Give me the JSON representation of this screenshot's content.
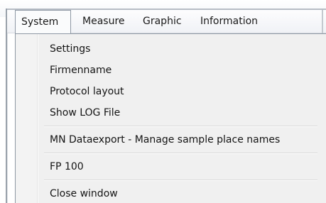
{
  "menubar": {
    "items": [
      {
        "label": "System"
      },
      {
        "label": "Measure"
      },
      {
        "label": "Graphic"
      },
      {
        "label": "Information"
      }
    ]
  },
  "dropdown": {
    "items": [
      {
        "label": "Settings"
      },
      {
        "label": "Firmenname"
      },
      {
        "label": "Protocol layout"
      },
      {
        "label": "Show LOG File"
      },
      {
        "label": "MN Dataexport - Manage sample place names"
      },
      {
        "label": "FP 100"
      },
      {
        "label": "Close window"
      }
    ]
  },
  "colors": {
    "menu_background": "#f0f0f0",
    "menu_border": "#8e98a4",
    "text": "#141414"
  }
}
